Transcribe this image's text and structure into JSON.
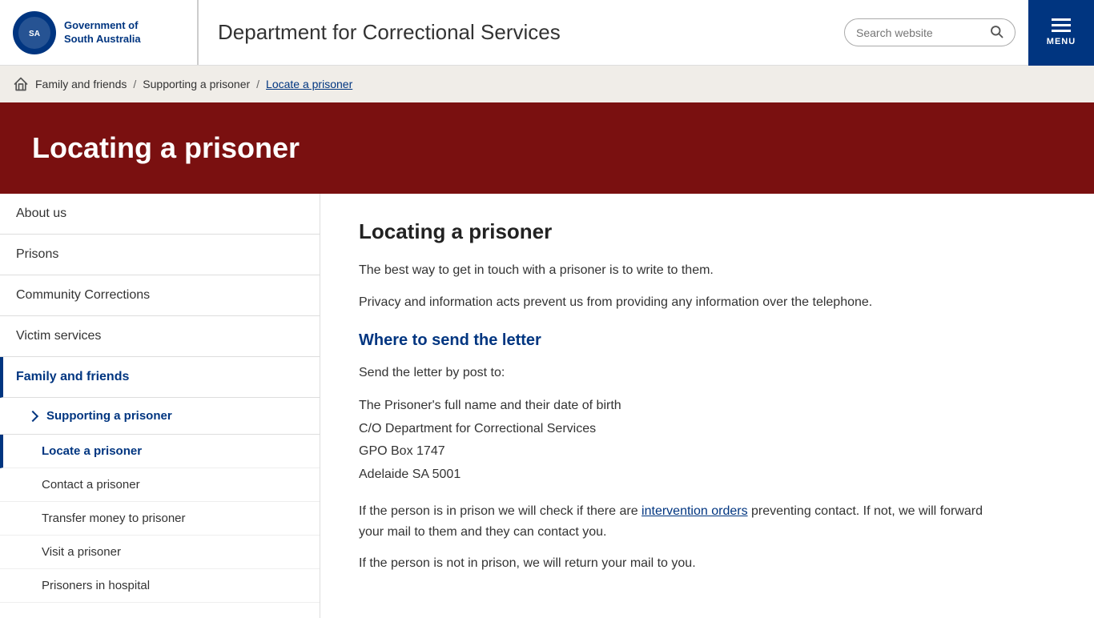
{
  "header": {
    "logo_line1": "Government of",
    "logo_line2": "South Australia",
    "dept_title": "Department for Correctional Services",
    "search_placeholder": "Search website",
    "menu_label": "MENU"
  },
  "breadcrumb": {
    "home_aria": "Home",
    "items": [
      {
        "label": "Family and friends",
        "link": true
      },
      {
        "label": "Supporting a prisoner",
        "link": true
      },
      {
        "label": "Locate a prisoner",
        "link": false,
        "active": true
      }
    ]
  },
  "hero": {
    "title": "Locating a prisoner"
  },
  "sidebar": {
    "items": [
      {
        "label": "About us",
        "active": false,
        "level": "top"
      },
      {
        "label": "Prisons",
        "active": false,
        "level": "top"
      },
      {
        "label": "Community Corrections",
        "active": false,
        "level": "top"
      },
      {
        "label": "Victim services",
        "active": false,
        "level": "top"
      },
      {
        "label": "Family and friends",
        "active": true,
        "level": "top"
      },
      {
        "label": "Supporting a prisoner",
        "active": false,
        "level": "sub",
        "expanded": true
      },
      {
        "label": "Locate a prisoner",
        "active": true,
        "level": "sub-child"
      },
      {
        "label": "Contact a prisoner",
        "active": false,
        "level": "sub-child"
      },
      {
        "label": "Transfer money to prisoner",
        "active": false,
        "level": "sub-child"
      },
      {
        "label": "Visit a prisoner",
        "active": false,
        "level": "sub-child"
      },
      {
        "label": "Prisoners in hospital",
        "active": false,
        "level": "sub-child"
      }
    ]
  },
  "content": {
    "heading": "Locating a prisoner",
    "para1": "The best way to get in touch with a prisoner is to write to them.",
    "para2": "Privacy and information acts prevent us from providing any information over the telephone.",
    "section1_heading": "Where to send the letter",
    "send_intro": "Send the letter by post to:",
    "address_line1": "The Prisoner's full name and their date of birth",
    "address_line2": "C/O Department for Correctional Services",
    "address_line3": "GPO Box 1747",
    "address_line4": "Adelaide SA 5001",
    "para3_before": "If the person is in prison we will check if there are ",
    "para3_link": "intervention orders",
    "para3_after": " preventing contact. If not, we will forward your mail to them and they can contact you.",
    "para4": "If the person is not in prison, we will return your mail to you."
  }
}
